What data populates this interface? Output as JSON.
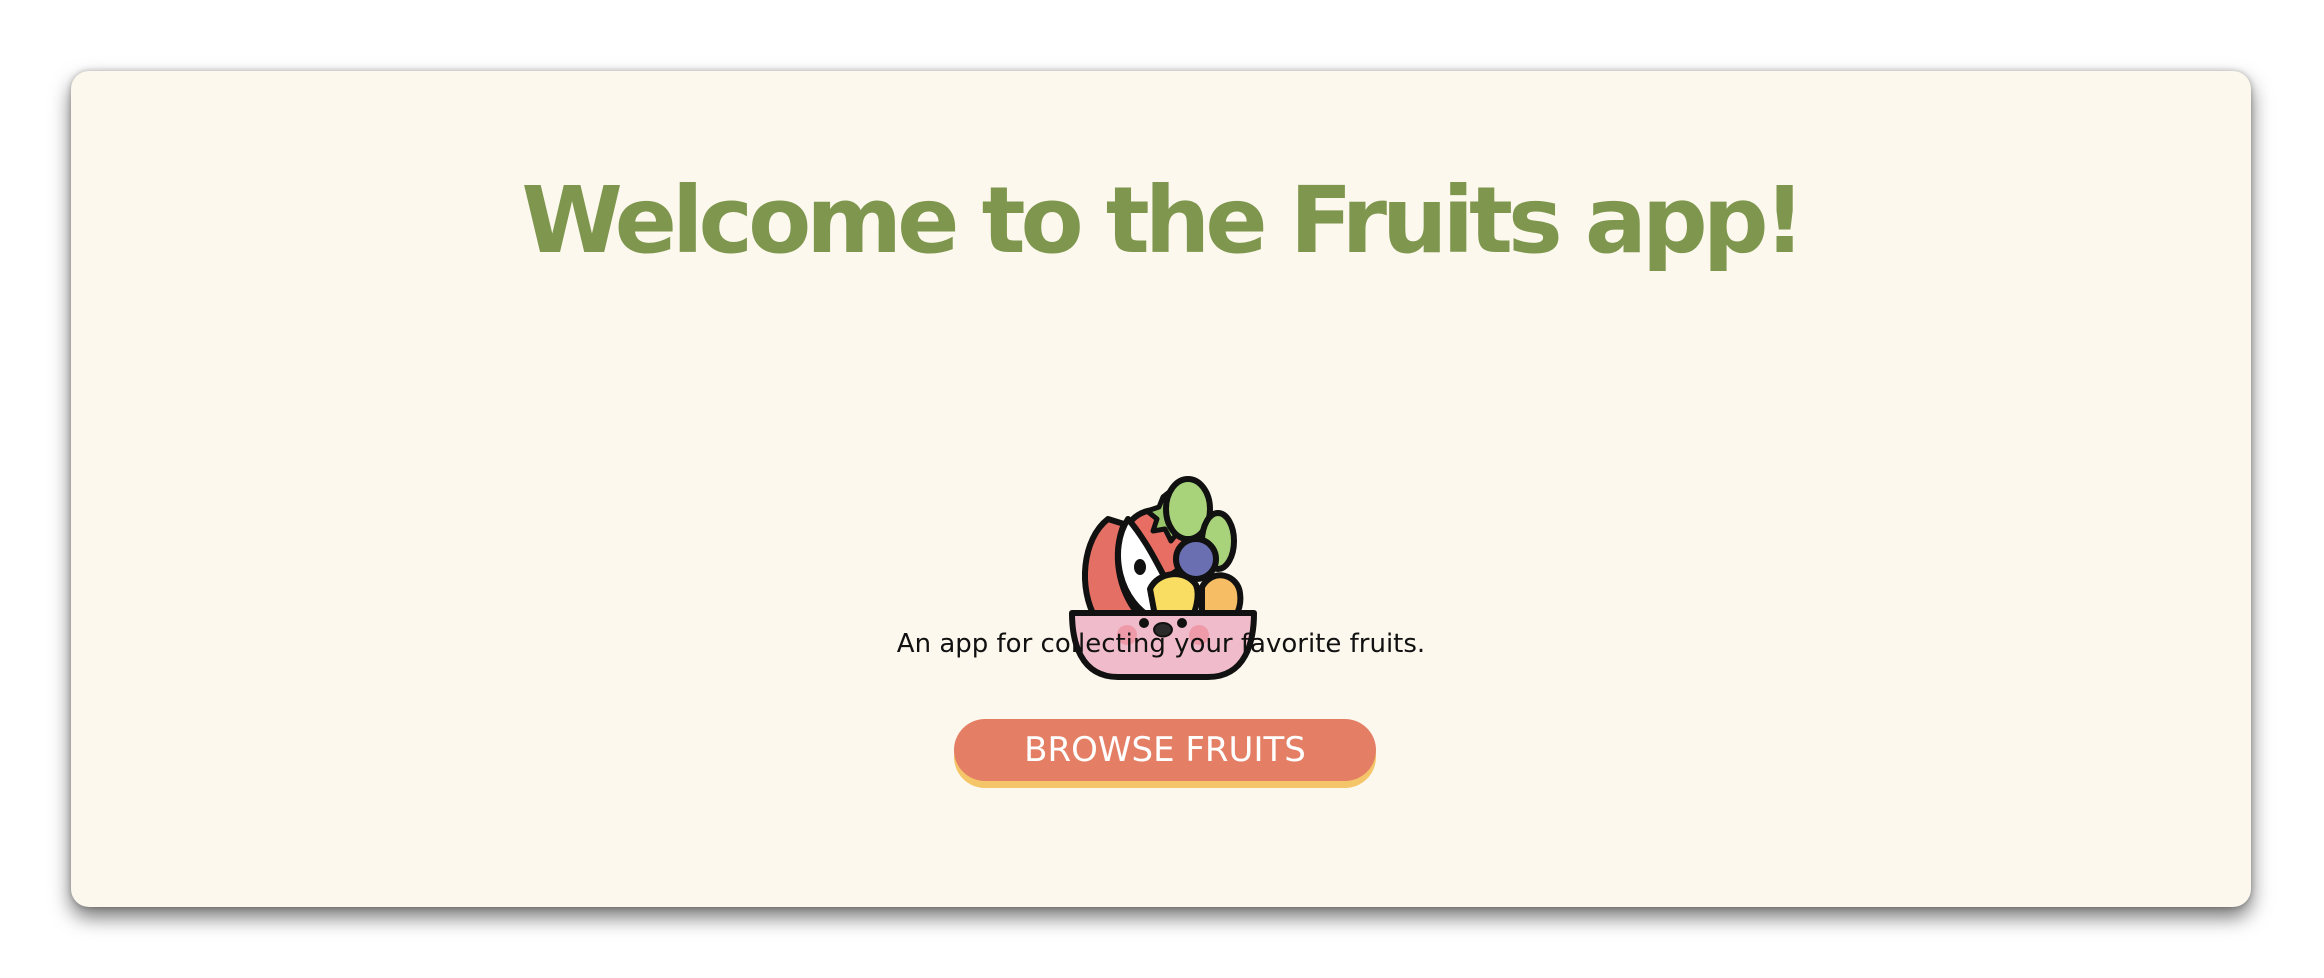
{
  "app": {
    "title": "Welcome to the Fruits app!",
    "tagline": "An app for collecting your favorite fruits.",
    "browse_button_label": "BROWSE FRUITS",
    "illustration_icon": "fruit-bowl-icon"
  },
  "colors": {
    "page_background": "#ffffff",
    "card_background": "#fcf8ed",
    "title_green": "#7e964d",
    "button_fill": "#e47f65",
    "button_underline": "#f5c56a",
    "text_dark": "#111111"
  }
}
